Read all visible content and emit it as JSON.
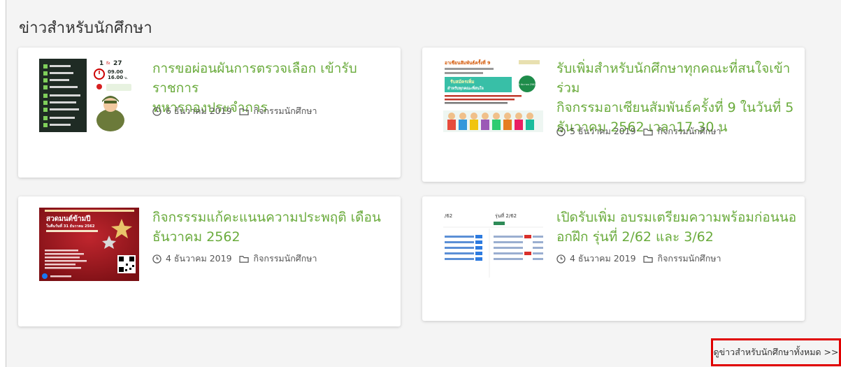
{
  "section": {
    "title": "ข่าวสำหรับนักศึกษา",
    "view_all": "ดูข่าวสำหรับนักศึกษาทั้งหมด >>"
  },
  "posts": [
    {
      "title_lines": [
        "การขอผ่อนผันการตรวจเลือก เข้ารับราชการ",
        "ทหารกองประจำการ"
      ],
      "date": "6 ธันวาคม 2019",
      "category": "กิจกรรมนักศึกษา",
      "thumb": {
        "day": "1",
        "sep": "ถึง",
        "day2": "27",
        "time_a": "09.00",
        "time_b": "16.00",
        "time_unit": "น."
      }
    },
    {
      "title_lines": [
        "รับเพิ่มสำหรับนักศึกษาทุกคณะที่สนใจเข้าร่วม",
        "กิจกรรมอาเซียนสัมพันธ์ครั้งที่ 9 ในวันที่ 5",
        "ธันวาคม 2562 เวลา17.30 น"
      ],
      "date": "5 ธันวาคม 2019",
      "category": "กิจกรรมนักศึกษา",
      "thumb": {
        "heading": "อาเซียนสัมพันธ์ครั้งที่ 9",
        "banner_a": "รับสมัครเพิ่ม",
        "banner_b": "สำหรับทุกคณะที่สนใจ",
        "badge": "5 ธันวาคม 2562"
      }
    },
    {
      "title_lines": [
        "กิจกรรรมแก้คะแนนความประพฤติ เดือน",
        "ธันวาคม 2562"
      ],
      "date": "4 ธันวาคม 2019",
      "category": "กิจกรรมนักศึกษา",
      "thumb": {
        "heading": "สวดมนต์ข้ามปี",
        "date_line": "ในคืนวันที่ 31 ธันวาคม 2562"
      }
    },
    {
      "title_lines": [
        "เปิดรับเพิ่ม อบรมเตรียมความพร้อมก่อนนอ",
        "อกฝึก รุ่นที่ 2/62 และ 3/62"
      ],
      "date": "4 ธันวาคม 2019",
      "category": "กิจกรรมนักศึกษา",
      "thumb": {
        "left_label": "/62",
        "right_label": "รุ่นที่ 2/62"
      }
    }
  ],
  "colors": {
    "title_green": "#6aab3c",
    "highlight_red": "#e00000",
    "background": "#f4f4f4"
  }
}
